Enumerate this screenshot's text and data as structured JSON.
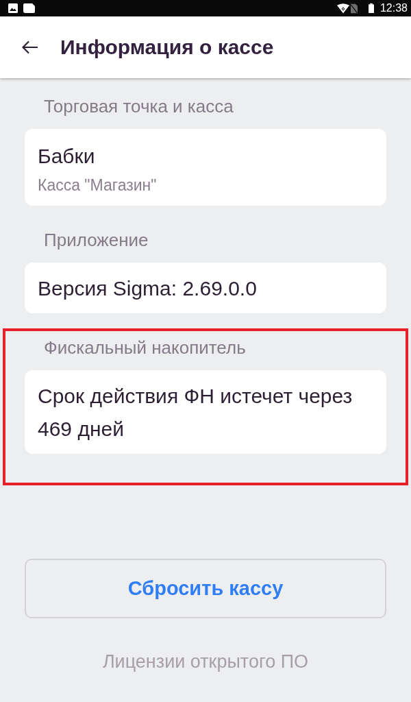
{
  "status_bar": {
    "time": "12:38"
  },
  "header": {
    "title": "Информация о кассе"
  },
  "sections": [
    {
      "label": "Торговая точка и касса",
      "highlighted": false,
      "card": {
        "title": "Бабки",
        "subtitle": "Касса \"Магазин\""
      }
    },
    {
      "label": "Приложение",
      "highlighted": false,
      "card": {
        "title": "Версия Sigma: 2.69.0.0"
      }
    },
    {
      "label": "Фискальный накопитель",
      "highlighted": true,
      "card": {
        "title": "Срок действия ФН истечет через 469 дней"
      }
    }
  ],
  "reset_button": {
    "label": "Сбросить кассу"
  },
  "licenses_link": {
    "label": "Лицензии открытого ПО"
  }
}
